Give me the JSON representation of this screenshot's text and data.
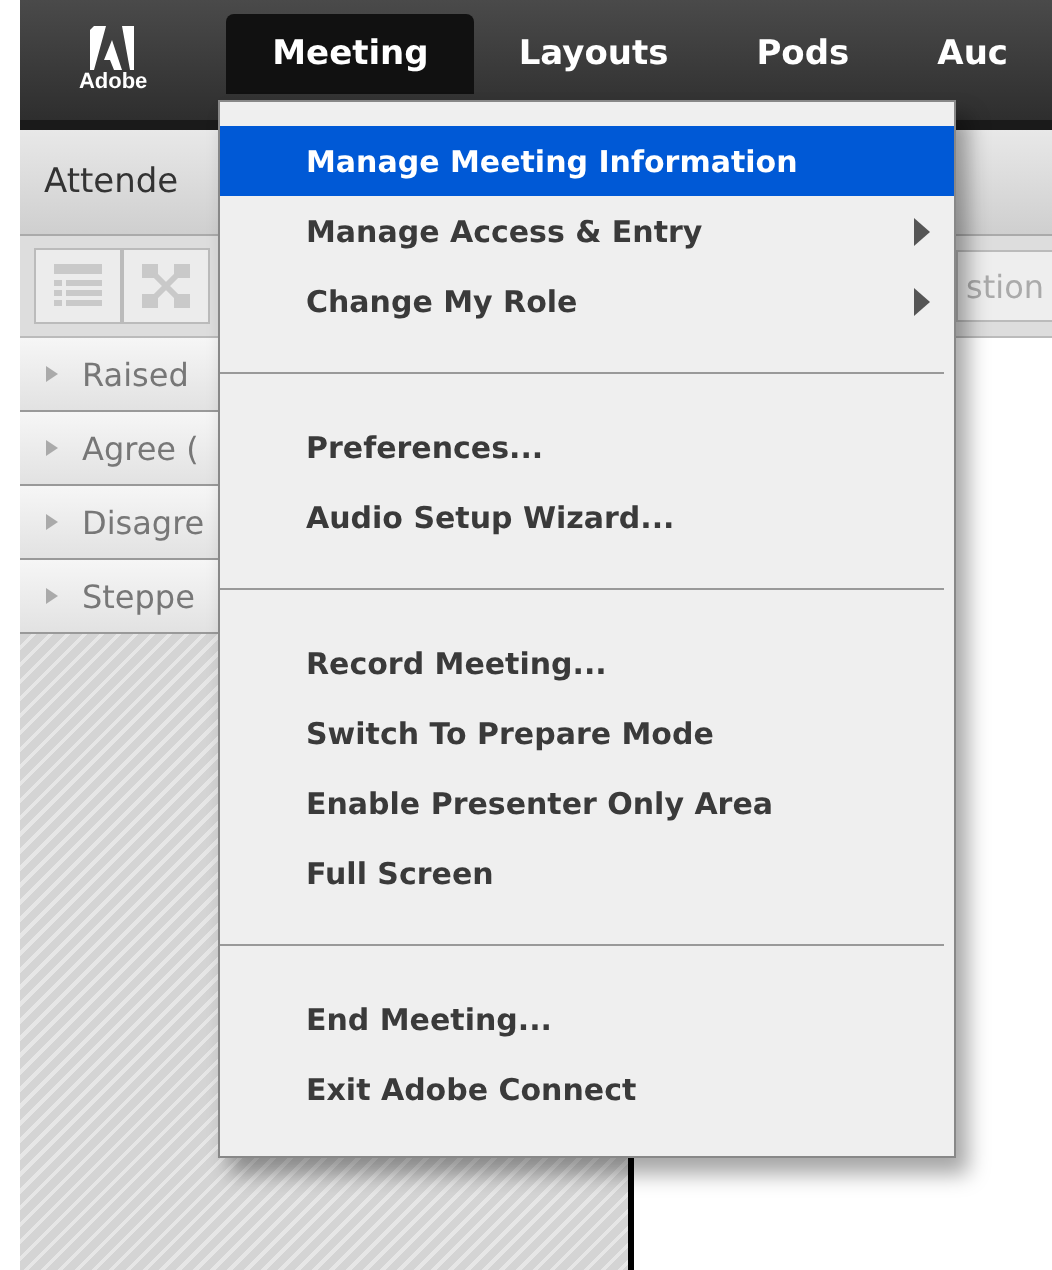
{
  "logo": {
    "text": "Adobe"
  },
  "app_bar": {
    "menus": [
      {
        "label": "Meeting",
        "selected": true
      },
      {
        "label": "Layouts",
        "selected": false
      },
      {
        "label": "Pods",
        "selected": false
      },
      {
        "label": "Auc",
        "selected": false
      }
    ]
  },
  "attendee_pod": {
    "title": "Attende",
    "sections": [
      "Raised",
      "Agree (",
      "Disagre",
      "Steppe"
    ]
  },
  "right_pod": {
    "tab": "stion"
  },
  "menu": {
    "groups": [
      [
        {
          "label": "Manage Meeting Information",
          "selected": true,
          "submenu": false
        },
        {
          "label": "Manage Access & Entry",
          "selected": false,
          "submenu": true
        },
        {
          "label": "Change My Role",
          "selected": false,
          "submenu": true
        }
      ],
      [
        {
          "label": "Preferences...",
          "selected": false,
          "submenu": false
        },
        {
          "label": "Audio Setup Wizard...",
          "selected": false,
          "submenu": false
        }
      ],
      [
        {
          "label": "Record Meeting...",
          "selected": false,
          "submenu": false
        },
        {
          "label": "Switch To Prepare Mode",
          "selected": false,
          "submenu": false
        },
        {
          "label": "Enable Presenter Only Area",
          "selected": false,
          "submenu": false
        },
        {
          "label": "Full Screen",
          "selected": false,
          "submenu": false
        }
      ],
      [
        {
          "label": "End Meeting...",
          "selected": false,
          "submenu": false
        },
        {
          "label": "Exit Adobe Connect",
          "selected": false,
          "submenu": false
        }
      ]
    ]
  }
}
